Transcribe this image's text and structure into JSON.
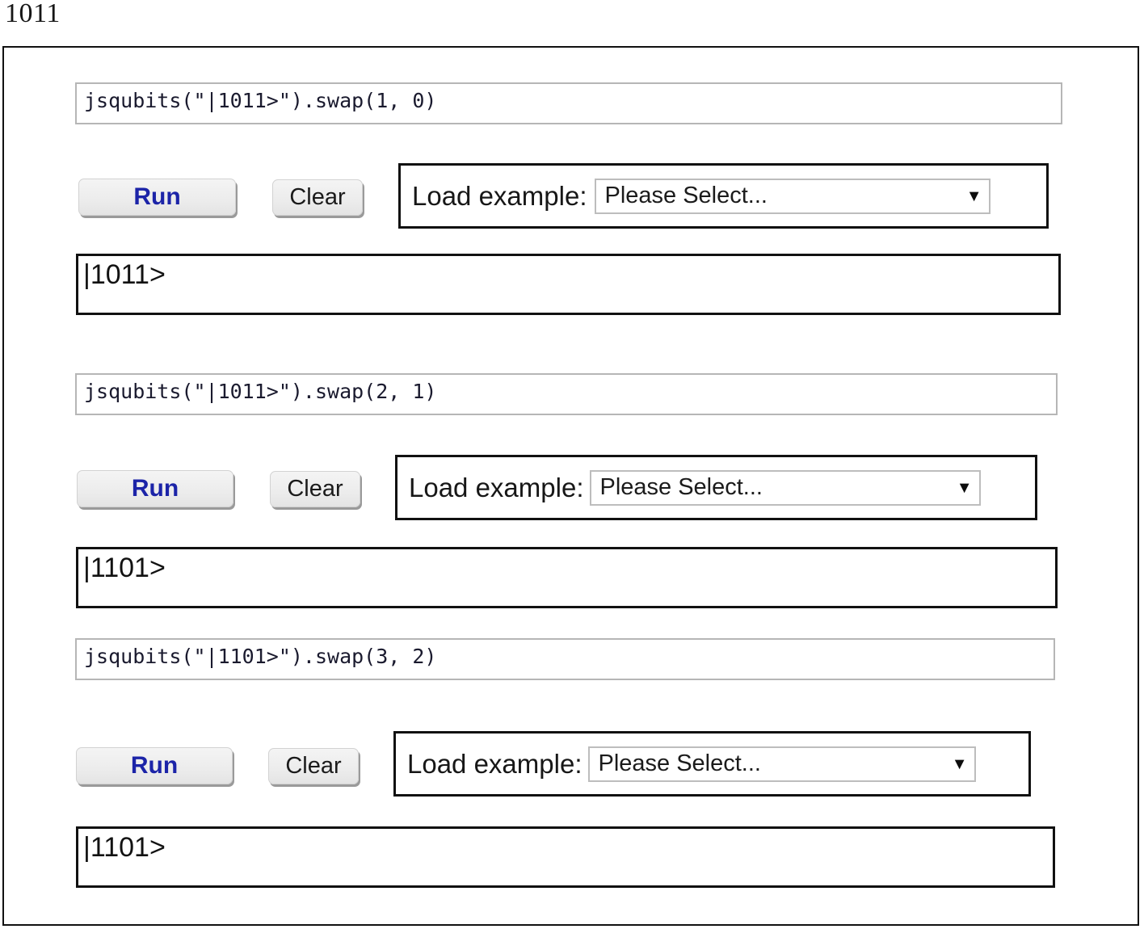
{
  "page": {
    "caption": "1011"
  },
  "common": {
    "run_label": "Run",
    "clear_label": "Clear",
    "load_example_label": "Load example:",
    "select_value": "Please Select...",
    "caret_icon": "▼",
    "accent_blue": "#1c24a8",
    "frame_color": "#111111",
    "input_border": "#b6b6b6"
  },
  "sections": [
    {
      "id": "section-1",
      "code": "jsqubits(\"|1011>\").swap(1, 0)",
      "result": "|1011>",
      "run_label": "Run",
      "clear_label": "Clear",
      "load_example_label": "Load example:",
      "select_value": "Please Select..."
    },
    {
      "id": "section-2",
      "code": "jsqubits(\"|1011>\").swap(2, 1)",
      "result": "|1101>",
      "run_label": "Run",
      "clear_label": "Clear",
      "load_example_label": "Load example:",
      "select_value": "Please Select..."
    },
    {
      "id": "section-3",
      "code": "jsqubits(\"|1101>\").swap(3, 2)",
      "result": "|1101>",
      "run_label": "Run",
      "clear_label": "Clear",
      "load_example_label": "Load example:",
      "select_value": "Please Select..."
    }
  ]
}
